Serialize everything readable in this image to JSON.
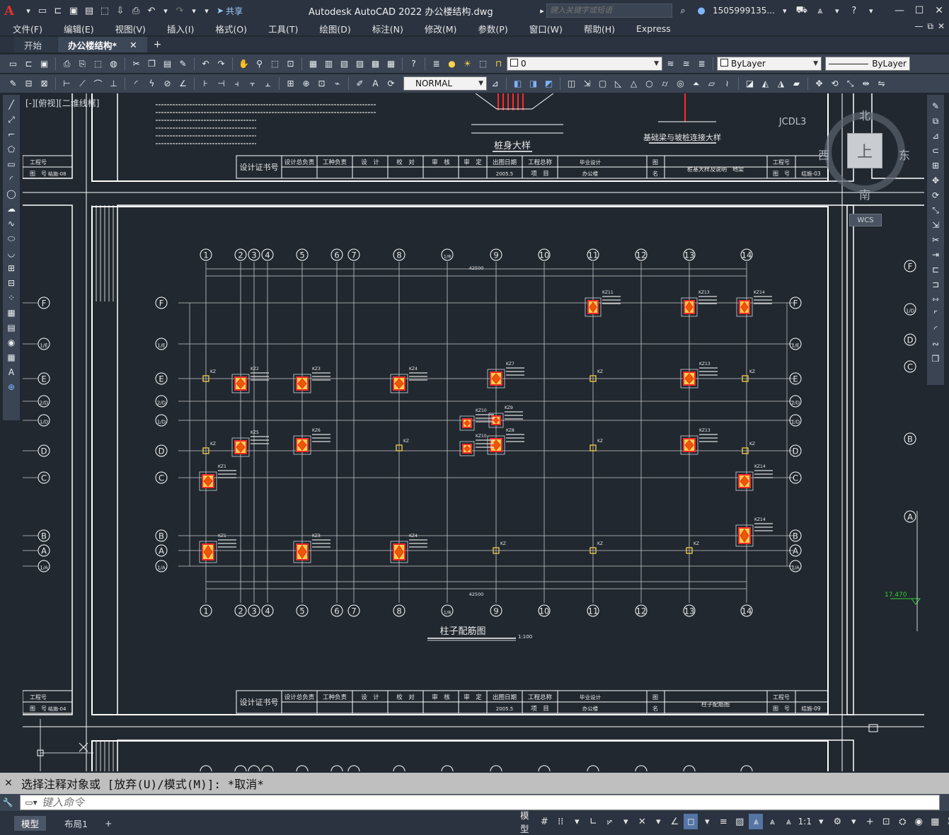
{
  "titlebar": {
    "app_logo": "A",
    "share_label": "共享",
    "title": "Autodesk AutoCAD 2022    办公楼结构.dwg",
    "search_placeholder": "键入关键字或短语",
    "user_name": "1505999135...",
    "qa_icons": [
      "new-icon",
      "open-icon",
      "save-icon",
      "save-as-icon",
      "publish-icon",
      "plot-icon",
      "undo-icon",
      "redo-icon"
    ]
  },
  "menubar": {
    "items": [
      "文件(F)",
      "编辑(E)",
      "视图(V)",
      "插入(I)",
      "格式(O)",
      "工具(T)",
      "绘图(D)",
      "标注(N)",
      "修改(M)",
      "参数(P)",
      "窗口(W)",
      "帮助(H)",
      "Express"
    ]
  },
  "tabs": {
    "items": [
      {
        "label": "开始"
      },
      {
        "label": "办公楼结构*"
      }
    ],
    "close_glyph": "✕",
    "add_glyph": "+"
  },
  "toolbar1": {
    "layer_value": "0",
    "color_value": "ByLayer",
    "linetype_value": "ByLayer"
  },
  "toolbar2": {
    "style_value": "NORMAL"
  },
  "viewport": {
    "label": "[-][俯视][二维线框]"
  },
  "viewcube": {
    "north": "北",
    "south": "南",
    "east": "东",
    "west": "西",
    "top": "上",
    "wcs": "WCS"
  },
  "drawing": {
    "plan_title": "柱子配筋图",
    "plan_scale": "1:100",
    "detail_title_1": "桩身大样",
    "detail_title_2": "基础梁与坡桩连接大样",
    "detail_label_3": "JCDL3",
    "title_block": {
      "cert_label": "设计证书号",
      "roles": [
        "设计总负责",
        "工种负责",
        "设　计",
        "校　对",
        "审　核",
        "审　定"
      ],
      "date_label": "出图日期",
      "project_label": "工程总称",
      "project_row_label": "项　目",
      "project_name": "毕业设计",
      "building": "办公楼",
      "date_value": "2005.5",
      "drawing_name_label": "图　名",
      "project_no_label": "工程号",
      "sheet_no_label": "图　号",
      "top_sheet_name": "桩基大样及说明　地梁",
      "top_sheet_no": "结施-03",
      "bottom_sheet_name": "柱子配筋图",
      "bottom_sheet_no": "结施-09",
      "left_sheet_no_top": "结施-08",
      "left_sheet_no_bottom": "结施-04"
    },
    "col_axes": [
      "1",
      "2",
      "3",
      "4",
      "5",
      "6",
      "7",
      "8",
      "1/8",
      "9",
      "10",
      "11",
      "12",
      "13",
      "14"
    ],
    "row_axes": [
      "F",
      "1/E",
      "E",
      "2/D",
      "1/D",
      "D",
      "C",
      "B",
      "A",
      "1/A"
    ],
    "dim_top": "42500",
    "dim_bottom": "42500",
    "elevation_value": "17.470",
    "column_tag": "KZ"
  },
  "command": {
    "history": "选择注释对象或 [放弃(U)/模式(M)]: *取消*",
    "input_placeholder": "键入命令"
  },
  "statusbar": {
    "layouts": [
      "模型",
      "布局1"
    ],
    "model_label": "模型",
    "scale": "1:1"
  },
  "colors": {
    "canvas_bg": "#212830",
    "toolbar_bg": "#3b4453",
    "frame_bg": "#2b3340",
    "column_red": "#ff2a2a",
    "column_fill": "#f0d14a",
    "grid_line": "#c8c8c8"
  }
}
